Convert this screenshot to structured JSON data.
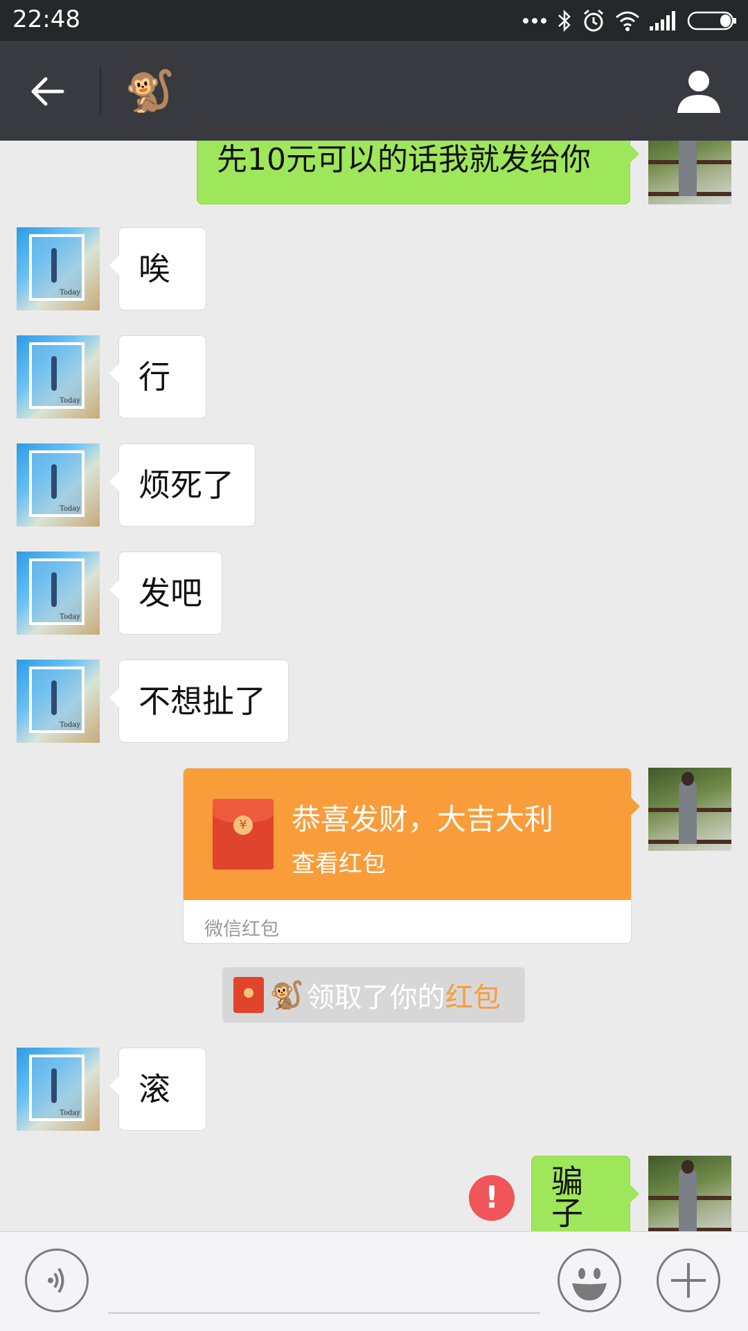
{
  "status_bar": {
    "time": "22:48",
    "icons": [
      "more-dots-icon",
      "bluetooth-icon",
      "alarm-icon",
      "wifi-icon",
      "signal-icon",
      "battery-icon"
    ]
  },
  "header": {
    "title_emoji": "🐒",
    "back_icon": "back-arrow-icon",
    "profile_icon": "person-icon"
  },
  "messages": [
    {
      "side": "right",
      "text": "先10元可以的话我就发给你"
    },
    {
      "side": "left",
      "text": "唉"
    },
    {
      "side": "left",
      "text": "行"
    },
    {
      "side": "left",
      "text": "烦死了"
    },
    {
      "side": "left",
      "text": "发吧"
    },
    {
      "side": "left",
      "text": "不想扯了"
    },
    {
      "side": "left",
      "text": "滚"
    },
    {
      "side": "right",
      "text": "骗子",
      "status": "failed"
    }
  ],
  "red_packet": {
    "title": "恭喜发财，大吉大利",
    "action": "查看红包",
    "footer": "微信红包",
    "coin_symbol": "¥"
  },
  "notice": {
    "who": "🐒",
    "text": "领取了你的",
    "link": "红包"
  },
  "failed_mark": "!",
  "input_bar": {
    "voice_icon": "voice-icon",
    "emoji_icon": "emoji-icon",
    "plus_icon": "plus-icon"
  },
  "colors": {
    "status_bar": "#26272b",
    "title_bar": "#393a3f",
    "chat_background": "#ebebeb",
    "bubble_right": "#9fe75a",
    "red_packet": "#f99d3b",
    "error": "#f0555a"
  }
}
